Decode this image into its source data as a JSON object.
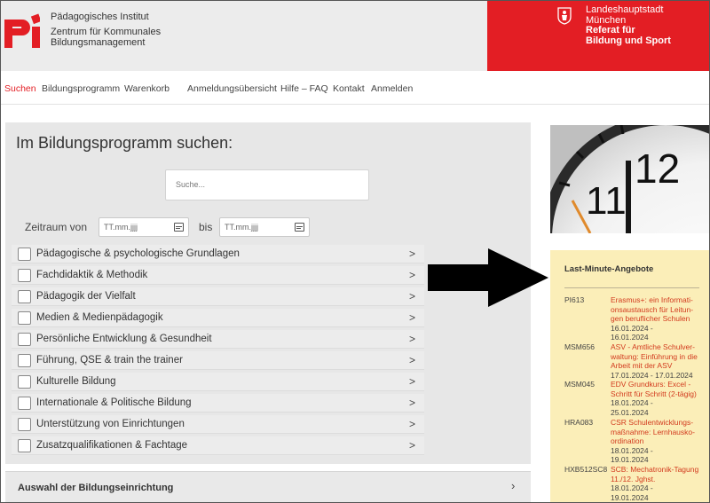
{
  "header": {
    "institute": [
      "Pädagogisches Institut",
      "Zentrum für Kommunales",
      "Bildungsmanagement"
    ],
    "city_lines": [
      "Landeshauptstadt",
      "München"
    ],
    "department_lines": [
      "Referat für",
      "Bildung und Sport"
    ],
    "brand_color": "#e31e24",
    "logo_icon": "pi-logo-icon",
    "crest_icon": "munich-crest-icon"
  },
  "nav": {
    "items": [
      {
        "label": "Suchen",
        "active": true
      },
      {
        "label": "Bildungsprogramm"
      },
      {
        "label": "Warenkorb"
      },
      {
        "label": "Anmeldungsübersicht"
      },
      {
        "label": "Hilfe – FAQ"
      },
      {
        "label": "Kontakt"
      },
      {
        "label": "Anmelden"
      }
    ]
  },
  "search": {
    "title": "Im Bildungsprogramm suchen:",
    "placeholder": "Suche...",
    "zeitraum_label": "Zeitraum von",
    "bis_label": "bis",
    "date_placeholder": "TT.mm.jjjj"
  },
  "categories": [
    "Pädagogische & psychologische Grundlagen",
    "Fachdidaktik & Methodik",
    "Pädagogik der Vielfalt",
    "Medien & Medienpädagogik",
    "Persönliche Entwicklung & Gesundheit",
    "Führung, QSE & train the trainer",
    "Kulturelle Bildung",
    "Internationale & Politische Bildung",
    "Unterstützung von Einrichtungen",
    "Zusatzqualifikationen & Fachtage"
  ],
  "chevron": ">",
  "auswahl": {
    "label": "Auswahl der Bildungseinrichtung",
    "chevron": "›"
  },
  "last_minute": {
    "title": "Last-Minute-Angebote",
    "offers": [
      {
        "code": "PI613",
        "title": [
          "Erasmus+: ein Informati-",
          "onsaustausch für Leitun-",
          "gen beruflicher Schulen"
        ],
        "dates": [
          "16.01.2024 -",
          "16.01.2024"
        ]
      },
      {
        "code": "MSM656",
        "title": [
          "ASV - Amtliche Schulver-",
          "waltung: Einführung in die",
          "Arbeit mit der ASV"
        ],
        "dates": [
          "17.01.2024 - 17.01.2024"
        ]
      },
      {
        "code": "MSM045",
        "title": [
          "EDV Grundkurs: Excel -",
          "Schritt für Schritt (2-tägig)"
        ],
        "dates": [
          "18.01.2024 -",
          "25.01.2024"
        ]
      },
      {
        "code": "HRA083",
        "title": [
          "CSR Schulentwicklungs-",
          "maßnahme: Lernhausko-",
          "ordination"
        ],
        "dates": [
          "18.01.2024 -",
          "19.01.2024"
        ]
      },
      {
        "code": "HXB512SC8",
        "title": [
          "SCB: Mechatronik-Tagung",
          "11./12. Jghst."
        ],
        "dates": [
          "18.01.2024 -",
          "19.01.2024"
        ]
      }
    ]
  },
  "clock_numbers": {
    "eleven": "11",
    "twelve": "12"
  },
  "icons": {
    "arrow": "black-arrow-right-icon",
    "calendar": "calendar-icon",
    "clock": "clock-photo"
  }
}
